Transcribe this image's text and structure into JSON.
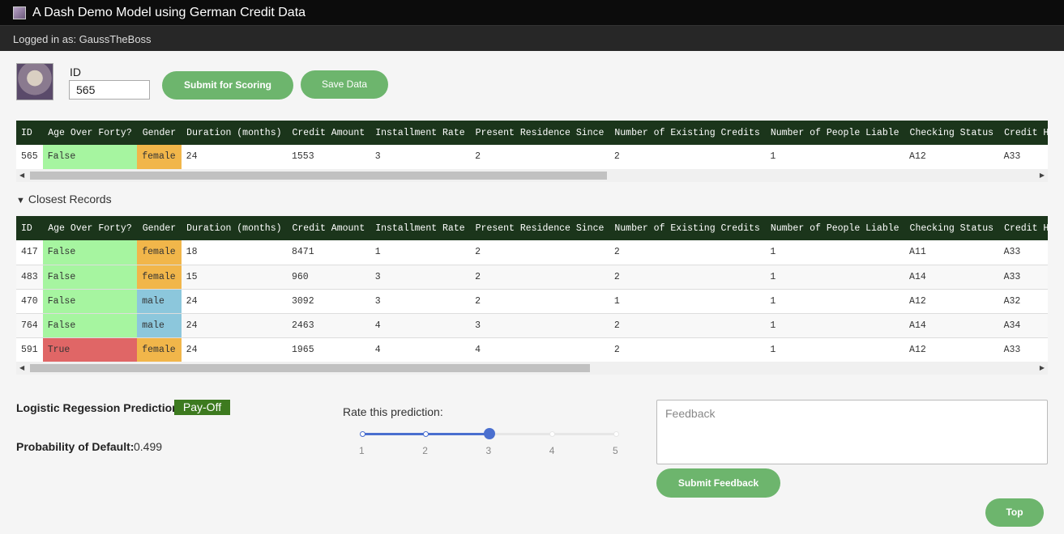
{
  "app": {
    "title": "A Dash Demo Model using German Credit Data",
    "user_text": "Logged in as: GaussTheBoss"
  },
  "form": {
    "id_label": "ID",
    "id_value": "565",
    "submit_label": "Submit for Scoring",
    "save_label": "Save Data"
  },
  "columns": [
    "ID",
    "Age Over Forty?",
    "Gender",
    "Duration (months)",
    "Credit Amount",
    "Installment Rate",
    "Present Residence Since",
    "Number of Existing Credits",
    "Number of People Liable",
    "Checking Status",
    "Credit History"
  ],
  "current_record": [
    [
      "565",
      "False",
      "female",
      "24",
      "1553",
      "3",
      "2",
      "2",
      "1",
      "A12",
      "A33"
    ]
  ],
  "closest_toggle": "Closest Records",
  "closest_records": [
    [
      "417",
      "False",
      "female",
      "18",
      "8471",
      "1",
      "2",
      "2",
      "1",
      "A11",
      "A33"
    ],
    [
      "483",
      "False",
      "female",
      "15",
      "960",
      "3",
      "2",
      "2",
      "1",
      "A14",
      "A33"
    ],
    [
      "470",
      "False",
      "male",
      "24",
      "3092",
      "3",
      "2",
      "1",
      "1",
      "A12",
      "A32"
    ],
    [
      "764",
      "False",
      "male",
      "24",
      "2463",
      "4",
      "3",
      "2",
      "1",
      "A14",
      "A34"
    ],
    [
      "591",
      "True",
      "female",
      "24",
      "1965",
      "4",
      "4",
      "2",
      "1",
      "A12",
      "A33"
    ]
  ],
  "prediction": {
    "label": "Logistic Regession Prediction:",
    "value": "Pay-Off",
    "prob_label": "Probability of Default:",
    "prob_value": "0.499"
  },
  "rating": {
    "label": "Rate this prediction:",
    "marks": [
      "1",
      "2",
      "3",
      "4",
      "5"
    ],
    "value": 3,
    "min": 1,
    "max": 5
  },
  "feedback": {
    "placeholder": "Feedback",
    "submit_label": "Submit Feedback"
  },
  "top_label": "Top",
  "colors": {
    "header_bg": "#1b351b",
    "age_false": "#a6f5a0",
    "age_true": "#e06666",
    "female": "#f1b64a",
    "male": "#8cc7dc",
    "button": "#6db56d",
    "slider": "#4a6fcf",
    "badge": "#3d7a1f"
  }
}
